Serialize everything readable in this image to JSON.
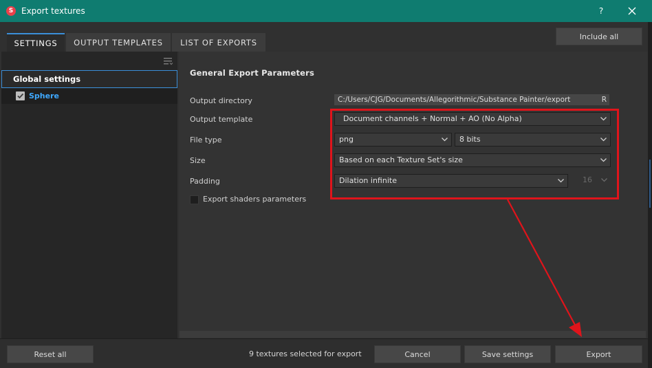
{
  "window": {
    "title": "Export textures",
    "help_label": "?"
  },
  "tabs": [
    {
      "label": "SETTINGS",
      "active": true
    },
    {
      "label": "OUTPUT TEMPLATES",
      "active": false
    },
    {
      "label": "LIST OF EXPORTS",
      "active": false
    }
  ],
  "header": {
    "include_all_label": "Include all"
  },
  "sidebar": {
    "global_label": "Global settings",
    "items": [
      {
        "label": "Sphere",
        "checked": true
      }
    ]
  },
  "params": {
    "section_title": "General Export Parameters",
    "output_directory": {
      "label": "Output directory",
      "value": "C:/Users/CJG/Documents/Allegorithmic/Substance Painter/export",
      "browse_label": "R"
    },
    "output_template": {
      "label": "Output template",
      "value": "Document channels + Normal + AO (No Alpha)"
    },
    "file_type": {
      "label": "File type",
      "format": "png",
      "bit_depth": "8 bits"
    },
    "size": {
      "label": "Size",
      "value": "Based on each Texture Set's size"
    },
    "padding": {
      "label": "Padding",
      "value": "Dilation infinite",
      "distance": "16"
    },
    "export_shaders": {
      "label": "Export shaders parameters",
      "checked": false
    }
  },
  "footer": {
    "reset_label": "Reset all",
    "status": "9 textures selected for export",
    "cancel_label": "Cancel",
    "save_label": "Save settings",
    "export_label": "Export"
  },
  "colors": {
    "title_bar": "#0f7c70",
    "accent": "#3b8fd9",
    "annotation": "#e0141b",
    "item_highlight": "#3fa9ff"
  }
}
